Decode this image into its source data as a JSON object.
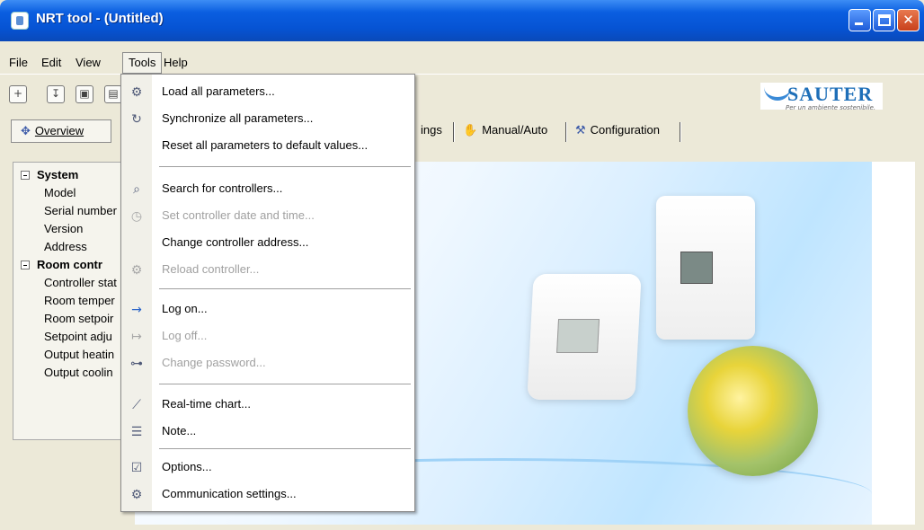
{
  "window": {
    "title": "NRT tool - (Untitled)"
  },
  "menubar": {
    "items": [
      {
        "label": "File"
      },
      {
        "label": "Edit"
      },
      {
        "label": "View"
      },
      {
        "label": "Tools"
      },
      {
        "label": "Help"
      }
    ]
  },
  "logo": {
    "name": "SAUTER",
    "slogan": "Per un ambiente sostenibile."
  },
  "tabs": {
    "overview": "Overview",
    "settings_partial": "ings",
    "manual_auto": "Manual/Auto",
    "configuration": "Configuration"
  },
  "tree": {
    "system_group": "System",
    "system_items": [
      "Model",
      "Serial number",
      "Version",
      "Address"
    ],
    "room_group": "Room contr",
    "room_items": [
      "Controller stat",
      "Room temper",
      "Room setpoir",
      "Setpoint adju",
      "Output heatin",
      "Output coolin"
    ]
  },
  "tools_menu": {
    "items": [
      {
        "label": "Load all parameters...",
        "icon": "load-params-icon",
        "enabled": true
      },
      {
        "label": "Synchronize all parameters...",
        "icon": "sync-icon",
        "enabled": true
      },
      {
        "label": "Reset all parameters to default values...",
        "icon": "",
        "enabled": true
      },
      {
        "label": "Search for controllers...",
        "icon": "search-controllers-icon",
        "enabled": true
      },
      {
        "label": "Set controller date and time...",
        "icon": "clock-icon",
        "enabled": false
      },
      {
        "label": "Change controller address...",
        "icon": "",
        "enabled": true
      },
      {
        "label": "Reload controller...",
        "icon": "reload-icon",
        "enabled": false
      },
      {
        "label": "Log on...",
        "icon": "log-on-icon",
        "enabled": true
      },
      {
        "label": "Log off...",
        "icon": "log-off-icon",
        "enabled": false
      },
      {
        "label": "Change password...",
        "icon": "key-icon",
        "enabled": false
      },
      {
        "label": "Real-time chart...",
        "icon": "chart-icon",
        "enabled": true
      },
      {
        "label": "Note...",
        "icon": "note-icon",
        "enabled": true
      },
      {
        "label": "Options...",
        "icon": "options-icon",
        "enabled": true
      },
      {
        "label": "Communication settings...",
        "icon": "communication-icon",
        "enabled": true
      }
    ]
  },
  "colors": {
    "title_blue": "#0653d3",
    "brand_blue": "#1e6fb8"
  }
}
